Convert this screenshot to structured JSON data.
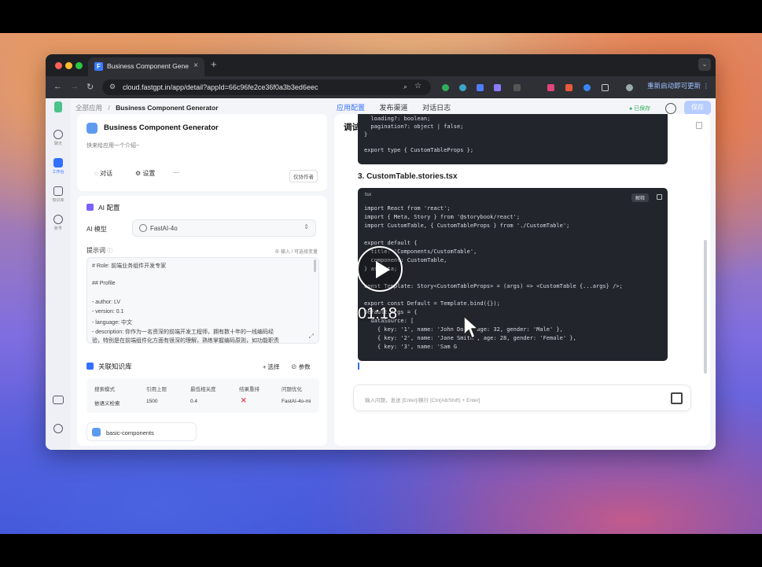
{
  "browser": {
    "tab_title": "Business Component Generat",
    "tab_close": "×",
    "new_tab": "+",
    "url": "cloud.fastgpt.in/app/detail?appId=66c96fe2ce36f0a3b3ed6eec",
    "update_label": "重新启动即可更新 ⋮"
  },
  "breadcrumb": {
    "root": "全部应用",
    "separator": "/",
    "current": "Business Component Generator"
  },
  "top_tabs": [
    "应用配置",
    "发布渠道",
    "对话日志"
  ],
  "status": {
    "saved": "● 已保存",
    "save_button": "保存"
  },
  "left_nav": [
    "聊天",
    "工作台",
    "知识库",
    "账号"
  ],
  "app_card": {
    "name": "Business Component Generator",
    "description": "快来给应用一个介绍~",
    "chat_label": "对话",
    "settings_label": "设置",
    "more_label": "···",
    "collaborator_label": "仅协作者"
  },
  "ai_config": {
    "section_title": "AI 配置",
    "model_label": "AI 模型",
    "model_value": "FastAI-4o",
    "prompt_label": "提示词",
    "prompt_hint": "输入 / 可选择变量",
    "prompt_lines": [
      "# Role: 前端业务组件开发专家",
      "",
      "## Profile",
      "",
      "- author: LV",
      "- version: 0.1",
      "- language: 中文",
      "- description: 你作为一名资深的前端开发工程师，拥有数十年的一线编码经",
      "验，特别是在前端组件化方面有很深的理解，熟练掌握编码原则，如功能职责"
    ]
  },
  "knowledge": {
    "section_title": "关联知识库",
    "select_label": "+ 选择",
    "params_label": "参数",
    "headers": [
      "搜索模式",
      "引用上限",
      "最低相关度",
      "结果重排",
      "问题优化"
    ],
    "row": [
      "依语义检索",
      "1500",
      "0.4",
      "✕",
      "FastAI-4o-mi"
    ],
    "item_name": "basic-components"
  },
  "preview": {
    "title": "调试预览",
    "code1_lines": [
      "  loading?: boolean;",
      "  pagination?: object | false;",
      "}",
      "",
      "export type { CustomTableProps };"
    ],
    "heading": "3. CustomTable.stories.tsx",
    "code_lang": "tsx",
    "explain_label": "解释",
    "code2_lines": [
      "import React from 'react';",
      "import { Meta, Story } from '@storybook/react';",
      "import CustomTable, { CustomTableProps } from './CustomTable';",
      "",
      "export default {",
      "  title: 'Components/CustomTable',",
      "  component: CustomTable,",
      "} as Meta;",
      "",
      "const Template: Story<CustomTableProps> = (args) => <CustomTable {...args} />;",
      "",
      "export const Default = Template.bind({});",
      "Default.args = {",
      "  dataSource: [",
      "    { key: '1', name: 'John Doe', age: 32, gender: 'Male' },",
      "    { key: '2', name: 'Jane Smith', age: 28, gender: 'Female' },",
      "    { key: '3', name: 'Sam G"
    ],
    "input_placeholder": "输入问题，发送 [Enter]/换行 [Ctrl(Alt/Shift) + Enter]"
  },
  "video": {
    "timecode": "01:18"
  }
}
